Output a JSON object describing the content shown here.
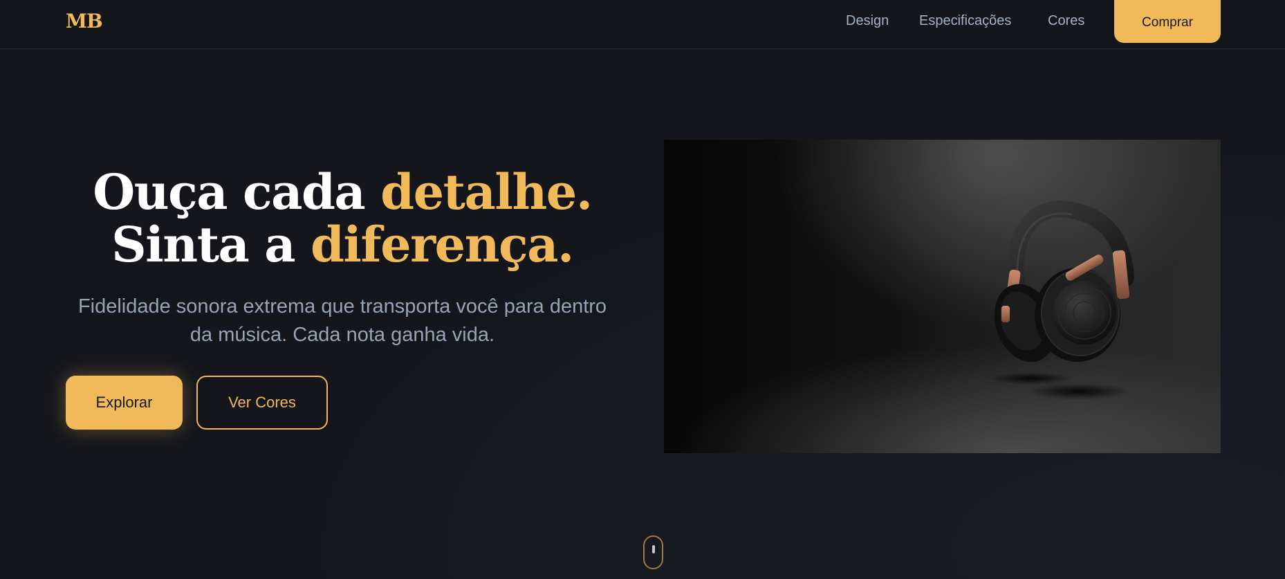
{
  "header": {
    "logo": "MB",
    "nav": [
      {
        "label": "Design"
      },
      {
        "label": "Especificações"
      },
      {
        "label": "Cores"
      }
    ],
    "cta_label": "Comprar"
  },
  "hero": {
    "title_line1_main": "Ouça cada ",
    "title_line1_accent": "detalhe.",
    "title_line2_main": "Sinta a ",
    "title_line2_accent": "diferença.",
    "subtitle": "Fidelidade sonora extrema que transporta você para dentro da música. Cada nota ganha vida.",
    "primary_button": "Explorar",
    "secondary_button": "Ver Cores",
    "image_subject": "headphones-image"
  },
  "colors": {
    "background": "#14161c",
    "accent": "#f0b95a",
    "headline": "#ffffff",
    "body_text": "#98a3b8",
    "nav_text": "#a7b1c4"
  },
  "icons": {
    "scroll": "mouse-scroll-icon"
  }
}
